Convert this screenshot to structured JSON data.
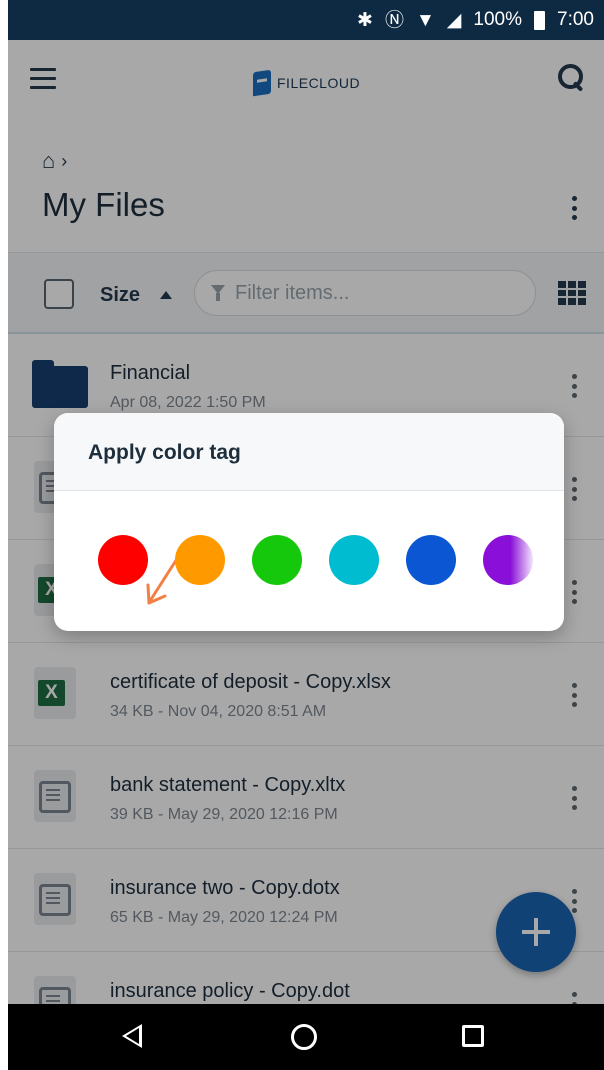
{
  "status_bar": {
    "icons": [
      "bluetooth-icon",
      "nfc-icon",
      "wifi-icon",
      "signal-icon",
      "battery-icon"
    ],
    "battery": "100%",
    "time": "7:00",
    "bluetooth_glyph": "✱",
    "nfc_glyph": "Ⓝ",
    "wifi_glyph": "▼",
    "signal_glyph": "◢"
  },
  "header": {
    "logo_text": "FILECLOUD"
  },
  "breadcrumb": {
    "separator": "›"
  },
  "page": {
    "title": "My Files"
  },
  "toolbar": {
    "sort_label": "Size",
    "filter_placeholder": "Filter items..."
  },
  "files": [
    {
      "type": "folder",
      "name": "Financial",
      "meta": "Apr 08, 2022 1:50 PM"
    },
    {
      "type": "doc",
      "name": "",
      "meta": ""
    },
    {
      "type": "xls",
      "name": "",
      "meta": ""
    },
    {
      "type": "xls",
      "name": "certificate of deposit - Copy.xlsx",
      "meta": "34 KB - Nov 04, 2020 8:51 AM"
    },
    {
      "type": "doc",
      "name": "bank statement - Copy.xltx",
      "meta": "39 KB - May 29, 2020 12:16 PM"
    },
    {
      "type": "doc",
      "name": "insurance two - Copy.dotx",
      "meta": "65 KB - May 29, 2020 12:24 PM"
    },
    {
      "type": "doc",
      "name": "insurance policy - Copy.dot",
      "meta": ""
    }
  ],
  "dialog": {
    "title": "Apply color tag",
    "colors": [
      {
        "name": "red",
        "hex": "#ff0000"
      },
      {
        "name": "orange",
        "hex": "#ff9900"
      },
      {
        "name": "green",
        "hex": "#16c80c"
      },
      {
        "name": "cyan",
        "hex": "#00bcd0"
      },
      {
        "name": "blue",
        "hex": "#0b56d3"
      },
      {
        "name": "purple",
        "hex": "#8a0fd8"
      }
    ],
    "annotation_color": "#f28045"
  },
  "colors": {
    "status_bar_bg": "#0e2a42",
    "fab_bg": "#1964b3",
    "primary_text": "#1d2e3d"
  }
}
